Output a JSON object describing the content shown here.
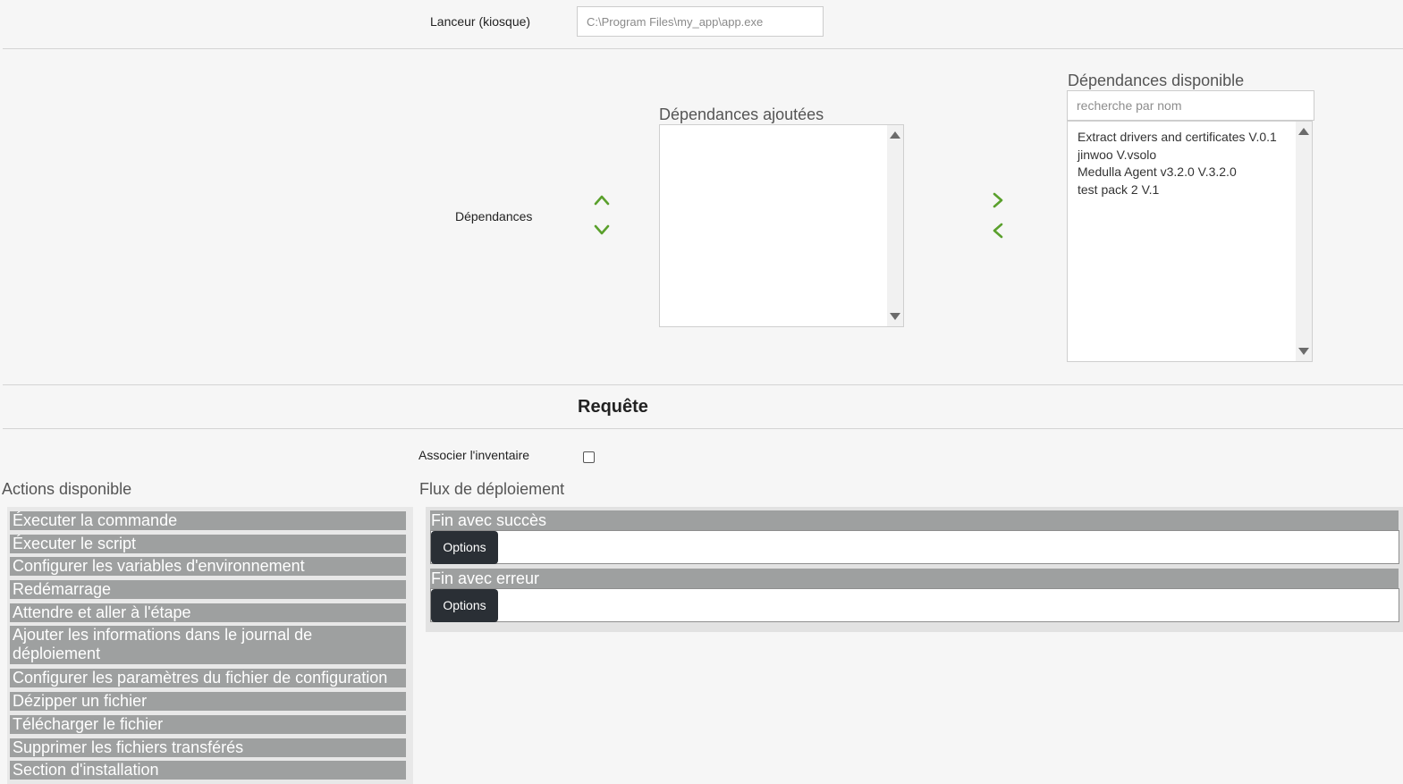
{
  "launcher": {
    "label": "Lanceur (kiosque)",
    "placeholder": "C:\\Program Files\\my_app\\app.exe"
  },
  "dependencies": {
    "label": "Dépendances",
    "added_title": "Dépendances ajoutées",
    "available_title": "Dépendances disponible",
    "search_placeholder": "recherche par nom",
    "available_items": [
      "Extract drivers and certificates V.0.1",
      "jinwoo V.vsolo",
      "Medulla Agent v3.2.0 V.3.2.0",
      "test pack 2 V.1"
    ],
    "arrow_color": "#5aa02c"
  },
  "request": {
    "title": "Requête",
    "associate_label": "Associer l'inventaire",
    "associate_checked": false
  },
  "actions": {
    "title": "Actions disponible",
    "items": [
      "Éxecuter la commande",
      "Éxecuter le script",
      "Configurer les variables d'environnement",
      "Redémarrage",
      "Attendre et aller à l'étape",
      "Ajouter les informations dans le journal de déploiement",
      "Configurer les paramètres du fichier de configuration",
      "Dézipper un fichier",
      "Télécharger le fichier",
      "Supprimer les fichiers transférés",
      "Section d'installation"
    ]
  },
  "flow": {
    "title": "Flux de déploiement",
    "steps": [
      {
        "title": "Fin avec succès",
        "button": "Options"
      },
      {
        "title": "Fin avec erreur",
        "button": "Options"
      }
    ]
  }
}
